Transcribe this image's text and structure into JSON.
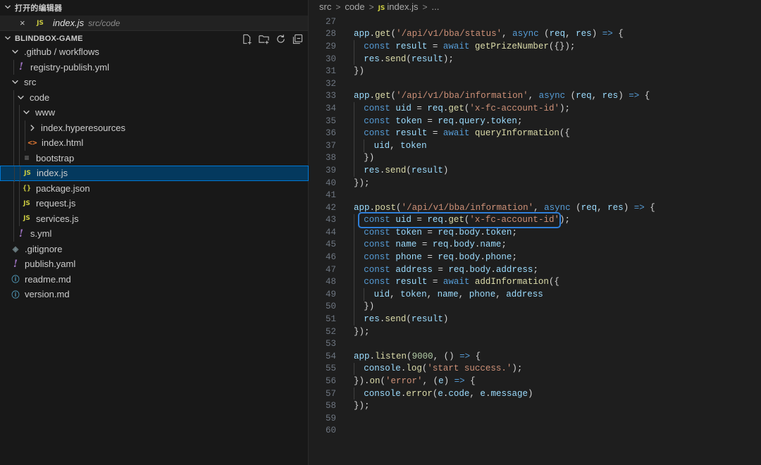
{
  "sidebar": {
    "open_editors": {
      "title": "打开的编辑器",
      "items": [
        {
          "close": "×",
          "badge": "JS",
          "name": "index.js",
          "path": "src/code"
        }
      ]
    },
    "project": {
      "title": "BLINDBOX-GAME",
      "tree": [
        {
          "label": ".github / workflows",
          "depth": 0,
          "kind": "folder-open",
          "icon": "chevron-down-icon"
        },
        {
          "label": "registry-publish.yml",
          "depth": 1,
          "kind": "file",
          "icon": "yaml-file-icon",
          "glyph": "!"
        },
        {
          "label": "src",
          "depth": 0,
          "kind": "folder-open",
          "icon": "chevron-down-icon"
        },
        {
          "label": "code",
          "depth": 1,
          "kind": "folder-open",
          "icon": "chevron-down-icon"
        },
        {
          "label": "www",
          "depth": 2,
          "kind": "folder-open",
          "icon": "chevron-down-icon"
        },
        {
          "label": "index.hyperesources",
          "depth": 3,
          "kind": "folder-closed",
          "icon": "chevron-right-icon"
        },
        {
          "label": "index.html",
          "depth": 3,
          "kind": "file",
          "icon": "html-file-icon",
          "glyph": "<>"
        },
        {
          "label": "bootstrap",
          "depth": 2,
          "kind": "file",
          "icon": "text-file-icon",
          "glyph": "≡"
        },
        {
          "label": "index.js",
          "depth": 2,
          "kind": "file",
          "icon": "js-file-icon",
          "glyph": "JS",
          "selected": true
        },
        {
          "label": "package.json",
          "depth": 2,
          "kind": "file",
          "icon": "json-file-icon",
          "glyph": "{}"
        },
        {
          "label": "request.js",
          "depth": 2,
          "kind": "file",
          "icon": "js-file-icon",
          "glyph": "JS"
        },
        {
          "label": "services.js",
          "depth": 2,
          "kind": "file",
          "icon": "js-file-icon",
          "glyph": "JS"
        },
        {
          "label": "s.yml",
          "depth": 1,
          "kind": "file",
          "icon": "yaml-file-icon",
          "glyph": "!"
        },
        {
          "label": ".gitignore",
          "depth": 0,
          "kind": "file",
          "icon": "gitignore-file-icon",
          "glyph": "◈"
        },
        {
          "label": "publish.yaml",
          "depth": 0,
          "kind": "file",
          "icon": "yaml-file-icon",
          "glyph": "!"
        },
        {
          "label": "readme.md",
          "depth": 0,
          "kind": "file",
          "icon": "markdown-file-icon",
          "glyph": "ⓘ"
        },
        {
          "label": "version.md",
          "depth": 0,
          "kind": "file",
          "icon": "markdown-file-icon",
          "glyph": "ⓘ"
        }
      ]
    }
  },
  "editor": {
    "breadcrumb": {
      "parts": [
        "src",
        "code"
      ],
      "file_badge": "JS",
      "file": "index.js",
      "tail": "..."
    },
    "lines": [
      {
        "n": "27",
        "i": 0,
        "t": []
      },
      {
        "n": "28",
        "i": 0,
        "t": [
          [
            "t-var",
            "app"
          ],
          [
            "t-p",
            "."
          ],
          [
            "t-fn",
            "get"
          ],
          [
            "t-p",
            "("
          ],
          [
            "t-str",
            "'/api/v1/bba/status'"
          ],
          [
            "t-p",
            ", "
          ],
          [
            "t-kw",
            "async"
          ],
          [
            "t-p",
            " ("
          ],
          [
            "t-var",
            "req"
          ],
          [
            "t-p",
            ", "
          ],
          [
            "t-var",
            "res"
          ],
          [
            "t-p",
            ") "
          ],
          [
            "t-kw",
            "=>"
          ],
          [
            "t-p",
            " {"
          ]
        ]
      },
      {
        "n": "29",
        "i": 1,
        "t": [
          [
            "t-kw",
            "const"
          ],
          [
            "t-p",
            " "
          ],
          [
            "t-var",
            "result"
          ],
          [
            "t-p",
            " = "
          ],
          [
            "t-kw",
            "await"
          ],
          [
            "t-p",
            " "
          ],
          [
            "t-fn",
            "getPrizeNumber"
          ],
          [
            "t-p",
            "({});"
          ]
        ]
      },
      {
        "n": "30",
        "i": 1,
        "t": [
          [
            "t-var",
            "res"
          ],
          [
            "t-p",
            "."
          ],
          [
            "t-fn",
            "send"
          ],
          [
            "t-p",
            "("
          ],
          [
            "t-var",
            "result"
          ],
          [
            "t-p",
            ");"
          ]
        ]
      },
      {
        "n": "31",
        "i": 0,
        "t": [
          [
            "t-p",
            "})"
          ]
        ]
      },
      {
        "n": "32",
        "i": 0,
        "t": []
      },
      {
        "n": "33",
        "i": 0,
        "t": [
          [
            "t-var",
            "app"
          ],
          [
            "t-p",
            "."
          ],
          [
            "t-fn",
            "get"
          ],
          [
            "t-p",
            "("
          ],
          [
            "t-str",
            "'/api/v1/bba/information'"
          ],
          [
            "t-p",
            ", "
          ],
          [
            "t-kw",
            "async"
          ],
          [
            "t-p",
            " ("
          ],
          [
            "t-var",
            "req"
          ],
          [
            "t-p",
            ", "
          ],
          [
            "t-var",
            "res"
          ],
          [
            "t-p",
            ") "
          ],
          [
            "t-kw",
            "=>"
          ],
          [
            "t-p",
            " {"
          ]
        ]
      },
      {
        "n": "34",
        "i": 1,
        "t": [
          [
            "t-kw",
            "const"
          ],
          [
            "t-p",
            " "
          ],
          [
            "t-var",
            "uid"
          ],
          [
            "t-p",
            " = "
          ],
          [
            "t-var",
            "req"
          ],
          [
            "t-p",
            "."
          ],
          [
            "t-fn",
            "get"
          ],
          [
            "t-p",
            "("
          ],
          [
            "t-str",
            "'x-fc-account-id'"
          ],
          [
            "t-p",
            ");"
          ]
        ]
      },
      {
        "n": "35",
        "i": 1,
        "t": [
          [
            "t-kw",
            "const"
          ],
          [
            "t-p",
            " "
          ],
          [
            "t-var",
            "token"
          ],
          [
            "t-p",
            " = "
          ],
          [
            "t-var",
            "req"
          ],
          [
            "t-p",
            "."
          ],
          [
            "t-var",
            "query"
          ],
          [
            "t-p",
            "."
          ],
          [
            "t-var",
            "token"
          ],
          [
            "t-p",
            ";"
          ]
        ]
      },
      {
        "n": "36",
        "i": 1,
        "t": [
          [
            "t-kw",
            "const"
          ],
          [
            "t-p",
            " "
          ],
          [
            "t-var",
            "result"
          ],
          [
            "t-p",
            " = "
          ],
          [
            "t-kw",
            "await"
          ],
          [
            "t-p",
            " "
          ],
          [
            "t-fn",
            "queryInformation"
          ],
          [
            "t-p",
            "({"
          ]
        ]
      },
      {
        "n": "37",
        "i": 2,
        "t": [
          [
            "t-var",
            "uid"
          ],
          [
            "t-p",
            ", "
          ],
          [
            "t-var",
            "token"
          ]
        ]
      },
      {
        "n": "38",
        "i": 1,
        "t": [
          [
            "t-p",
            "})"
          ]
        ]
      },
      {
        "n": "39",
        "i": 1,
        "t": [
          [
            "t-var",
            "res"
          ],
          [
            "t-p",
            "."
          ],
          [
            "t-fn",
            "send"
          ],
          [
            "t-p",
            "("
          ],
          [
            "t-var",
            "result"
          ],
          [
            "t-p",
            ")"
          ]
        ]
      },
      {
        "n": "40",
        "i": 0,
        "t": [
          [
            "t-p",
            "});"
          ]
        ]
      },
      {
        "n": "41",
        "i": 0,
        "t": []
      },
      {
        "n": "42",
        "i": 0,
        "t": [
          [
            "t-var",
            "app"
          ],
          [
            "t-p",
            "."
          ],
          [
            "t-fn",
            "post"
          ],
          [
            "t-p",
            "("
          ],
          [
            "t-str",
            "'/api/v1/bba/information'"
          ],
          [
            "t-p",
            ", "
          ],
          [
            "t-kw",
            "async"
          ],
          [
            "t-p",
            " ("
          ],
          [
            "t-var",
            "req"
          ],
          [
            "t-p",
            ", "
          ],
          [
            "t-var",
            "res"
          ],
          [
            "t-p",
            ") "
          ],
          [
            "t-kw",
            "=>"
          ],
          [
            "t-p",
            " {"
          ]
        ]
      },
      {
        "n": "43",
        "i": 1,
        "t": [
          [
            "t-kw",
            "const"
          ],
          [
            "t-p",
            " "
          ],
          [
            "t-var",
            "uid"
          ],
          [
            "t-p",
            " = "
          ],
          [
            "t-var",
            "req"
          ],
          [
            "t-p",
            "."
          ],
          [
            "t-fn",
            "get"
          ],
          [
            "t-p",
            "("
          ],
          [
            "t-str",
            "'x-fc-account-id'"
          ],
          [
            "t-p",
            ");"
          ]
        ]
      },
      {
        "n": "44",
        "i": 1,
        "t": [
          [
            "t-kw",
            "const"
          ],
          [
            "t-p",
            " "
          ],
          [
            "t-var",
            "token"
          ],
          [
            "t-p",
            " = "
          ],
          [
            "t-var",
            "req"
          ],
          [
            "t-p",
            "."
          ],
          [
            "t-var",
            "body"
          ],
          [
            "t-p",
            "."
          ],
          [
            "t-var",
            "token"
          ],
          [
            "t-p",
            ";"
          ]
        ]
      },
      {
        "n": "45",
        "i": 1,
        "t": [
          [
            "t-kw",
            "const"
          ],
          [
            "t-p",
            " "
          ],
          [
            "t-var",
            "name"
          ],
          [
            "t-p",
            " = "
          ],
          [
            "t-var",
            "req"
          ],
          [
            "t-p",
            "."
          ],
          [
            "t-var",
            "body"
          ],
          [
            "t-p",
            "."
          ],
          [
            "t-var",
            "name"
          ],
          [
            "t-p",
            ";"
          ]
        ]
      },
      {
        "n": "46",
        "i": 1,
        "t": [
          [
            "t-kw",
            "const"
          ],
          [
            "t-p",
            " "
          ],
          [
            "t-var",
            "phone"
          ],
          [
            "t-p",
            " = "
          ],
          [
            "t-var",
            "req"
          ],
          [
            "t-p",
            "."
          ],
          [
            "t-var",
            "body"
          ],
          [
            "t-p",
            "."
          ],
          [
            "t-var",
            "phone"
          ],
          [
            "t-p",
            ";"
          ]
        ]
      },
      {
        "n": "47",
        "i": 1,
        "t": [
          [
            "t-kw",
            "const"
          ],
          [
            "t-p",
            " "
          ],
          [
            "t-var",
            "address"
          ],
          [
            "t-p",
            " = "
          ],
          [
            "t-var",
            "req"
          ],
          [
            "t-p",
            "."
          ],
          [
            "t-var",
            "body"
          ],
          [
            "t-p",
            "."
          ],
          [
            "t-var",
            "address"
          ],
          [
            "t-p",
            ";"
          ]
        ]
      },
      {
        "n": "48",
        "i": 1,
        "t": [
          [
            "t-kw",
            "const"
          ],
          [
            "t-p",
            " "
          ],
          [
            "t-var",
            "result"
          ],
          [
            "t-p",
            " = "
          ],
          [
            "t-kw",
            "await"
          ],
          [
            "t-p",
            " "
          ],
          [
            "t-fn",
            "addInformation"
          ],
          [
            "t-p",
            "({"
          ]
        ]
      },
      {
        "n": "49",
        "i": 2,
        "t": [
          [
            "t-var",
            "uid"
          ],
          [
            "t-p",
            ", "
          ],
          [
            "t-var",
            "token"
          ],
          [
            "t-p",
            ", "
          ],
          [
            "t-var",
            "name"
          ],
          [
            "t-p",
            ", "
          ],
          [
            "t-var",
            "phone"
          ],
          [
            "t-p",
            ", "
          ],
          [
            "t-var",
            "address"
          ]
        ]
      },
      {
        "n": "50",
        "i": 1,
        "t": [
          [
            "t-p",
            "})"
          ]
        ]
      },
      {
        "n": "51",
        "i": 1,
        "t": [
          [
            "t-var",
            "res"
          ],
          [
            "t-p",
            "."
          ],
          [
            "t-fn",
            "send"
          ],
          [
            "t-p",
            "("
          ],
          [
            "t-var",
            "result"
          ],
          [
            "t-p",
            ")"
          ]
        ]
      },
      {
        "n": "52",
        "i": 0,
        "t": [
          [
            "t-p",
            "});"
          ]
        ]
      },
      {
        "n": "53",
        "i": 0,
        "t": []
      },
      {
        "n": "54",
        "i": 0,
        "t": [
          [
            "t-var",
            "app"
          ],
          [
            "t-p",
            "."
          ],
          [
            "t-fn",
            "listen"
          ],
          [
            "t-p",
            "("
          ],
          [
            "t-num",
            "9000"
          ],
          [
            "t-p",
            ", () "
          ],
          [
            "t-kw",
            "=>"
          ],
          [
            "t-p",
            " {"
          ]
        ]
      },
      {
        "n": "55",
        "i": 1,
        "t": [
          [
            "t-var",
            "console"
          ],
          [
            "t-p",
            "."
          ],
          [
            "t-fn",
            "log"
          ],
          [
            "t-p",
            "("
          ],
          [
            "t-str",
            "'start success.'"
          ],
          [
            "t-p",
            ");"
          ]
        ]
      },
      {
        "n": "56",
        "i": 0,
        "t": [
          [
            "t-p",
            "})."
          ],
          [
            "t-fn",
            "on"
          ],
          [
            "t-p",
            "("
          ],
          [
            "t-str",
            "'error'"
          ],
          [
            "t-p",
            ", ("
          ],
          [
            "t-var",
            "e"
          ],
          [
            "t-p",
            ") "
          ],
          [
            "t-kw",
            "=>"
          ],
          [
            "t-p",
            " {"
          ]
        ]
      },
      {
        "n": "57",
        "i": 1,
        "t": [
          [
            "t-var",
            "console"
          ],
          [
            "t-p",
            "."
          ],
          [
            "t-fn",
            "error"
          ],
          [
            "t-p",
            "("
          ],
          [
            "t-var",
            "e"
          ],
          [
            "t-p",
            "."
          ],
          [
            "t-var",
            "code"
          ],
          [
            "t-p",
            ", "
          ],
          [
            "t-var",
            "e"
          ],
          [
            "t-p",
            "."
          ],
          [
            "t-var",
            "message"
          ],
          [
            "t-p",
            ")"
          ]
        ]
      },
      {
        "n": "58",
        "i": 0,
        "t": [
          [
            "t-p",
            "});"
          ]
        ]
      },
      {
        "n": "59",
        "i": 0,
        "t": []
      },
      {
        "n": "60",
        "i": 0,
        "t": []
      }
    ],
    "highlighted_line": "43"
  }
}
